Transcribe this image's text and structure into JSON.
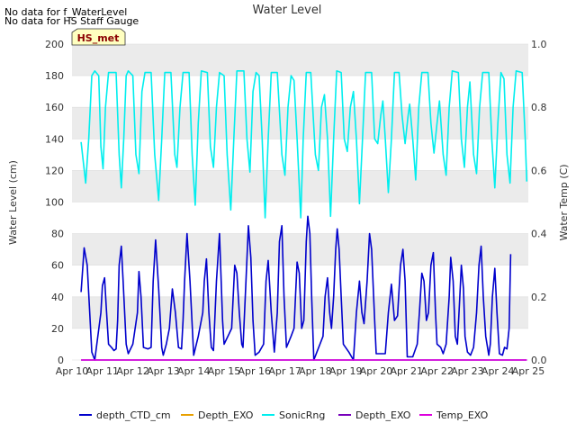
{
  "notes": [
    "No data for f_WaterLevel",
    "No data for HS Staff Gauge"
  ],
  "chart_data": {
    "type": "line",
    "title": "Water Level",
    "ylabel": "Water Level (cm)",
    "y2label": "Water Temp (C)",
    "ylim": [
      0,
      200
    ],
    "y2lim": [
      0.0,
      1.0
    ],
    "xlim": [
      "Apr 10",
      "Apr 25"
    ],
    "x_ticks": [
      "Apr 10",
      "Apr 11",
      "Apr 12",
      "Apr 13",
      "Apr 14",
      "Apr 15",
      "Apr 16",
      "Apr 17",
      "Apr 18",
      "Apr 19",
      "Apr 20",
      "Apr 21",
      "Apr 22",
      "Apr 23",
      "Apr 24",
      "Apr 25"
    ],
    "y_ticks": [
      0,
      20,
      40,
      60,
      80,
      100,
      120,
      140,
      160,
      180,
      200
    ],
    "y2_ticks": [
      "0.0",
      "0.2",
      "0.4",
      "0.6",
      "0.8",
      "1.0"
    ],
    "grid": "horizontal bands",
    "legend_location": "bottom",
    "annotation": {
      "text": "HS_met",
      "bg": "#ffffc0",
      "color": "#8b0000"
    },
    "series": [
      {
        "name": "depth_CTD_cm",
        "color": "#0000cc",
        "axis": "left",
        "points": [
          [
            0.3,
            43
          ],
          [
            0.4,
            71
          ],
          [
            0.5,
            60
          ],
          [
            0.65,
            5
          ],
          [
            0.75,
            0
          ],
          [
            0.85,
            15
          ],
          [
            0.95,
            30
          ],
          [
            1.0,
            47
          ],
          [
            1.07,
            52
          ],
          [
            1.12,
            35
          ],
          [
            1.2,
            10
          ],
          [
            1.3,
            8
          ],
          [
            1.38,
            6
          ],
          [
            1.45,
            7
          ],
          [
            1.5,
            25
          ],
          [
            1.55,
            60
          ],
          [
            1.62,
            72
          ],
          [
            1.68,
            50
          ],
          [
            1.78,
            10
          ],
          [
            1.85,
            4
          ],
          [
            2.0,
            10
          ],
          [
            2.15,
            30
          ],
          [
            2.2,
            56
          ],
          [
            2.27,
            40
          ],
          [
            2.35,
            8
          ],
          [
            2.5,
            7
          ],
          [
            2.6,
            8
          ],
          [
            2.67,
            50
          ],
          [
            2.75,
            76
          ],
          [
            2.85,
            45
          ],
          [
            2.95,
            8
          ],
          [
            3.0,
            3
          ],
          [
            3.1,
            10
          ],
          [
            3.2,
            20
          ],
          [
            3.3,
            45
          ],
          [
            3.4,
            30
          ],
          [
            3.5,
            8
          ],
          [
            3.6,
            7
          ],
          [
            3.65,
            25
          ],
          [
            3.7,
            50
          ],
          [
            3.78,
            80
          ],
          [
            3.88,
            50
          ],
          [
            4.0,
            3
          ],
          [
            4.15,
            15
          ],
          [
            4.3,
            30
          ],
          [
            4.35,
            50
          ],
          [
            4.42,
            64
          ],
          [
            4.5,
            30
          ],
          [
            4.58,
            8
          ],
          [
            4.65,
            6
          ],
          [
            4.75,
            50
          ],
          [
            4.85,
            80
          ],
          [
            4.95,
            25
          ],
          [
            5.0,
            10
          ],
          [
            5.1,
            14
          ],
          [
            5.25,
            20
          ],
          [
            5.35,
            60
          ],
          [
            5.42,
            55
          ],
          [
            5.5,
            30
          ],
          [
            5.58,
            10
          ],
          [
            5.62,
            8
          ],
          [
            5.72,
            50
          ],
          [
            5.8,
            85
          ],
          [
            5.88,
            65
          ],
          [
            5.95,
            25
          ],
          [
            6.02,
            3
          ],
          [
            6.15,
            5
          ],
          [
            6.3,
            10
          ],
          [
            6.38,
            50
          ],
          [
            6.45,
            63
          ],
          [
            6.55,
            30
          ],
          [
            6.65,
            5
          ],
          [
            6.75,
            30
          ],
          [
            6.82,
            75
          ],
          [
            6.9,
            85
          ],
          [
            6.97,
            40
          ],
          [
            7.05,
            8
          ],
          [
            7.2,
            15
          ],
          [
            7.3,
            20
          ],
          [
            7.4,
            62
          ],
          [
            7.47,
            55
          ],
          [
            7.55,
            20
          ],
          [
            7.62,
            25
          ],
          [
            7.7,
            75
          ],
          [
            7.75,
            91
          ],
          [
            7.82,
            80
          ],
          [
            7.88,
            40
          ],
          [
            7.95,
            0
          ],
          [
            8.05,
            5
          ],
          [
            8.25,
            15
          ],
          [
            8.32,
            40
          ],
          [
            8.4,
            52
          ],
          [
            8.47,
            30
          ],
          [
            8.53,
            20
          ],
          [
            8.6,
            40
          ],
          [
            8.67,
            70
          ],
          [
            8.72,
            83
          ],
          [
            8.78,
            70
          ],
          [
            8.85,
            40
          ],
          [
            8.92,
            10
          ],
          [
            9.1,
            5
          ],
          [
            9.25,
            0
          ],
          [
            9.35,
            30
          ],
          [
            9.45,
            50
          ],
          [
            9.53,
            30
          ],
          [
            9.6,
            23
          ],
          [
            9.7,
            50
          ],
          [
            9.78,
            80
          ],
          [
            9.85,
            70
          ],
          [
            9.95,
            25
          ],
          [
            10.0,
            4
          ],
          [
            10.3,
            4
          ],
          [
            10.4,
            30
          ],
          [
            10.5,
            48
          ],
          [
            10.6,
            25
          ],
          [
            10.7,
            28
          ],
          [
            10.8,
            60
          ],
          [
            10.88,
            70
          ],
          [
            10.95,
            50
          ],
          [
            11.02,
            2
          ],
          [
            11.2,
            2
          ],
          [
            11.35,
            10
          ],
          [
            11.42,
            30
          ],
          [
            11.5,
            55
          ],
          [
            11.57,
            50
          ],
          [
            11.65,
            25
          ],
          [
            11.72,
            30
          ],
          [
            11.8,
            60
          ],
          [
            11.88,
            68
          ],
          [
            11.95,
            30
          ],
          [
            12.0,
            10
          ],
          [
            12.12,
            8
          ],
          [
            12.2,
            4
          ],
          [
            12.3,
            10
          ],
          [
            12.4,
            40
          ],
          [
            12.45,
            65
          ],
          [
            12.53,
            50
          ],
          [
            12.6,
            15
          ],
          [
            12.67,
            10
          ],
          [
            12.75,
            40
          ],
          [
            12.8,
            60
          ],
          [
            12.87,
            45
          ],
          [
            12.92,
            15
          ],
          [
            13.0,
            5
          ],
          [
            13.1,
            3
          ],
          [
            13.2,
            8
          ],
          [
            13.3,
            30
          ],
          [
            13.38,
            60
          ],
          [
            13.45,
            72
          ],
          [
            13.52,
            40
          ],
          [
            13.6,
            15
          ],
          [
            13.7,
            3
          ],
          [
            13.75,
            10
          ],
          [
            13.82,
            40
          ],
          [
            13.9,
            58
          ],
          [
            13.97,
            30
          ],
          [
            14.05,
            4
          ],
          [
            14.15,
            3
          ],
          [
            14.22,
            8
          ],
          [
            14.3,
            7
          ],
          [
            14.37,
            20
          ],
          [
            14.42,
            67
          ]
        ]
      },
      {
        "name": "Depth_EXO",
        "color": "#e8a000",
        "axis": "left",
        "points": []
      },
      {
        "name": "SonicRng",
        "color": "#00eeee",
        "axis": "left",
        "points": [
          [
            0.3,
            138
          ],
          [
            0.45,
            112
          ],
          [
            0.55,
            140
          ],
          [
            0.65,
            180
          ],
          [
            0.75,
            183
          ],
          [
            0.88,
            180
          ],
          [
            0.95,
            135
          ],
          [
            1.02,
            121
          ],
          [
            1.1,
            160
          ],
          [
            1.2,
            182
          ],
          [
            1.45,
            182
          ],
          [
            1.55,
            130
          ],
          [
            1.62,
            109
          ],
          [
            1.7,
            140
          ],
          [
            1.78,
            180
          ],
          [
            1.85,
            183
          ],
          [
            2.0,
            180
          ],
          [
            2.1,
            130
          ],
          [
            2.2,
            118
          ],
          [
            2.3,
            170
          ],
          [
            2.4,
            182
          ],
          [
            2.6,
            182
          ],
          [
            2.72,
            130
          ],
          [
            2.85,
            101
          ],
          [
            2.95,
            140
          ],
          [
            3.05,
            182
          ],
          [
            3.25,
            182
          ],
          [
            3.38,
            130
          ],
          [
            3.45,
            122
          ],
          [
            3.55,
            160
          ],
          [
            3.65,
            182
          ],
          [
            3.85,
            182
          ],
          [
            3.95,
            130
          ],
          [
            4.05,
            98
          ],
          [
            4.15,
            150
          ],
          [
            4.25,
            183
          ],
          [
            4.45,
            182
          ],
          [
            4.55,
            135
          ],
          [
            4.65,
            122
          ],
          [
            4.75,
            160
          ],
          [
            4.85,
            182
          ],
          [
            5.0,
            180
          ],
          [
            5.1,
            130
          ],
          [
            5.22,
            95
          ],
          [
            5.32,
            140
          ],
          [
            5.42,
            183
          ],
          [
            5.65,
            183
          ],
          [
            5.75,
            140
          ],
          [
            5.85,
            119
          ],
          [
            5.95,
            170
          ],
          [
            6.05,
            182
          ],
          [
            6.15,
            180
          ],
          [
            6.25,
            140
          ],
          [
            6.35,
            90
          ],
          [
            6.45,
            140
          ],
          [
            6.55,
            182
          ],
          [
            6.75,
            182
          ],
          [
            6.9,
            130
          ],
          [
            7.0,
            117
          ],
          [
            7.1,
            160
          ],
          [
            7.2,
            180
          ],
          [
            7.3,
            177
          ],
          [
            7.4,
            140
          ],
          [
            7.52,
            90
          ],
          [
            7.6,
            140
          ],
          [
            7.7,
            182
          ],
          [
            7.85,
            182
          ],
          [
            8.0,
            130
          ],
          [
            8.1,
            120
          ],
          [
            8.2,
            160
          ],
          [
            8.3,
            168
          ],
          [
            8.4,
            140
          ],
          [
            8.5,
            91
          ],
          [
            8.6,
            140
          ],
          [
            8.7,
            183
          ],
          [
            8.85,
            182
          ],
          [
            8.95,
            140
          ],
          [
            9.05,
            132
          ],
          [
            9.15,
            160
          ],
          [
            9.25,
            170
          ],
          [
            9.35,
            140
          ],
          [
            9.45,
            99
          ],
          [
            9.55,
            140
          ],
          [
            9.65,
            182
          ],
          [
            9.85,
            182
          ],
          [
            9.95,
            140
          ],
          [
            10.05,
            137
          ],
          [
            10.15,
            155
          ],
          [
            10.22,
            164
          ],
          [
            10.3,
            140
          ],
          [
            10.4,
            106
          ],
          [
            10.5,
            140
          ],
          [
            10.6,
            182
          ],
          [
            10.75,
            182
          ],
          [
            10.85,
            155
          ],
          [
            10.95,
            137
          ],
          [
            11.05,
            155
          ],
          [
            11.1,
            162
          ],
          [
            11.2,
            140
          ],
          [
            11.3,
            114
          ],
          [
            11.4,
            160
          ],
          [
            11.5,
            182
          ],
          [
            11.7,
            182
          ],
          [
            11.8,
            150
          ],
          [
            11.9,
            131
          ],
          [
            12.0,
            150
          ],
          [
            12.08,
            164
          ],
          [
            12.2,
            130
          ],
          [
            12.3,
            117
          ],
          [
            12.4,
            160
          ],
          [
            12.5,
            183
          ],
          [
            12.7,
            182
          ],
          [
            12.8,
            140
          ],
          [
            12.9,
            122
          ],
          [
            13.0,
            160
          ],
          [
            13.08,
            176
          ],
          [
            13.2,
            130
          ],
          [
            13.3,
            118
          ],
          [
            13.4,
            160
          ],
          [
            13.5,
            182
          ],
          [
            13.7,
            182
          ],
          [
            13.8,
            140
          ],
          [
            13.9,
            109
          ],
          [
            14.0,
            150
          ],
          [
            14.1,
            182
          ],
          [
            14.2,
            178
          ],
          [
            14.3,
            130
          ],
          [
            14.4,
            112
          ],
          [
            14.5,
            160
          ],
          [
            14.6,
            183
          ],
          [
            14.8,
            182
          ],
          [
            14.9,
            140
          ],
          [
            14.95,
            113
          ]
        ]
      },
      {
        "name": "Depth_EXO",
        "color": "#7700bb",
        "axis": "left",
        "points": [
          [
            0.3,
            0
          ],
          [
            14.95,
            0
          ]
        ]
      },
      {
        "name": "Temp_EXO",
        "color": "#dd00dd",
        "axis": "right",
        "points": [
          [
            0.3,
            0
          ],
          [
            14.95,
            0
          ]
        ]
      }
    ]
  }
}
